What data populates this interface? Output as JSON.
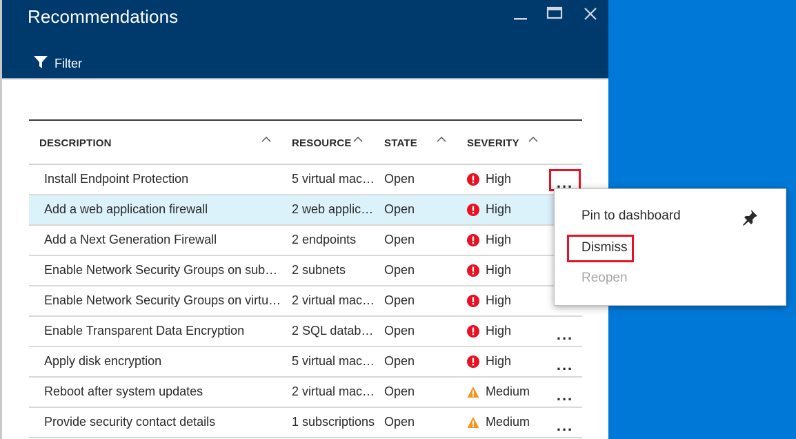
{
  "blade": {
    "title": "Recommendations",
    "filter_label": "Filter"
  },
  "window_controls": [
    "minimize-icon",
    "maximize-icon",
    "close-icon"
  ],
  "table": {
    "columns": [
      "DESCRIPTION",
      "RESOURCE",
      "STATE",
      "SEVERITY"
    ],
    "rows": [
      {
        "description": "Install Endpoint Protection",
        "resource": "5 virtual mac…",
        "state": "Open",
        "severity": "High"
      },
      {
        "description": "Add a web application firewall",
        "resource": "2 web applic…",
        "state": "Open",
        "severity": "High"
      },
      {
        "description": "Add a Next Generation Firewall",
        "resource": "2 endpoints",
        "state": "Open",
        "severity": "High"
      },
      {
        "description": "Enable Network Security Groups on subn…",
        "resource": "2 subnets",
        "state": "Open",
        "severity": "High"
      },
      {
        "description": "Enable Network Security Groups on virtu…",
        "resource": "2 virtual mac…",
        "state": "Open",
        "severity": "High"
      },
      {
        "description": "Enable Transparent Data Encryption",
        "resource": "2 SQL databa…",
        "state": "Open",
        "severity": "High"
      },
      {
        "description": "Apply disk encryption",
        "resource": "5 virtual mac…",
        "state": "Open",
        "severity": "High"
      },
      {
        "description": "Reboot after system updates",
        "resource": "2 virtual mac…",
        "state": "Open",
        "severity": "Medium"
      },
      {
        "description": "Provide security contact details",
        "resource": "1 subscriptions",
        "state": "Open",
        "severity": "Medium"
      }
    ],
    "more_label": "..."
  },
  "context_menu": {
    "items": [
      "Pin to dashboard",
      "Dismiss",
      "Reopen"
    ]
  },
  "colors": {
    "header_bg": "#003a6c",
    "background": "#0078d7",
    "high_severity": "#e81123",
    "medium_severity": "#f7941d",
    "highlight_box": "#e81123",
    "selected_row": "#dcf2fb"
  }
}
